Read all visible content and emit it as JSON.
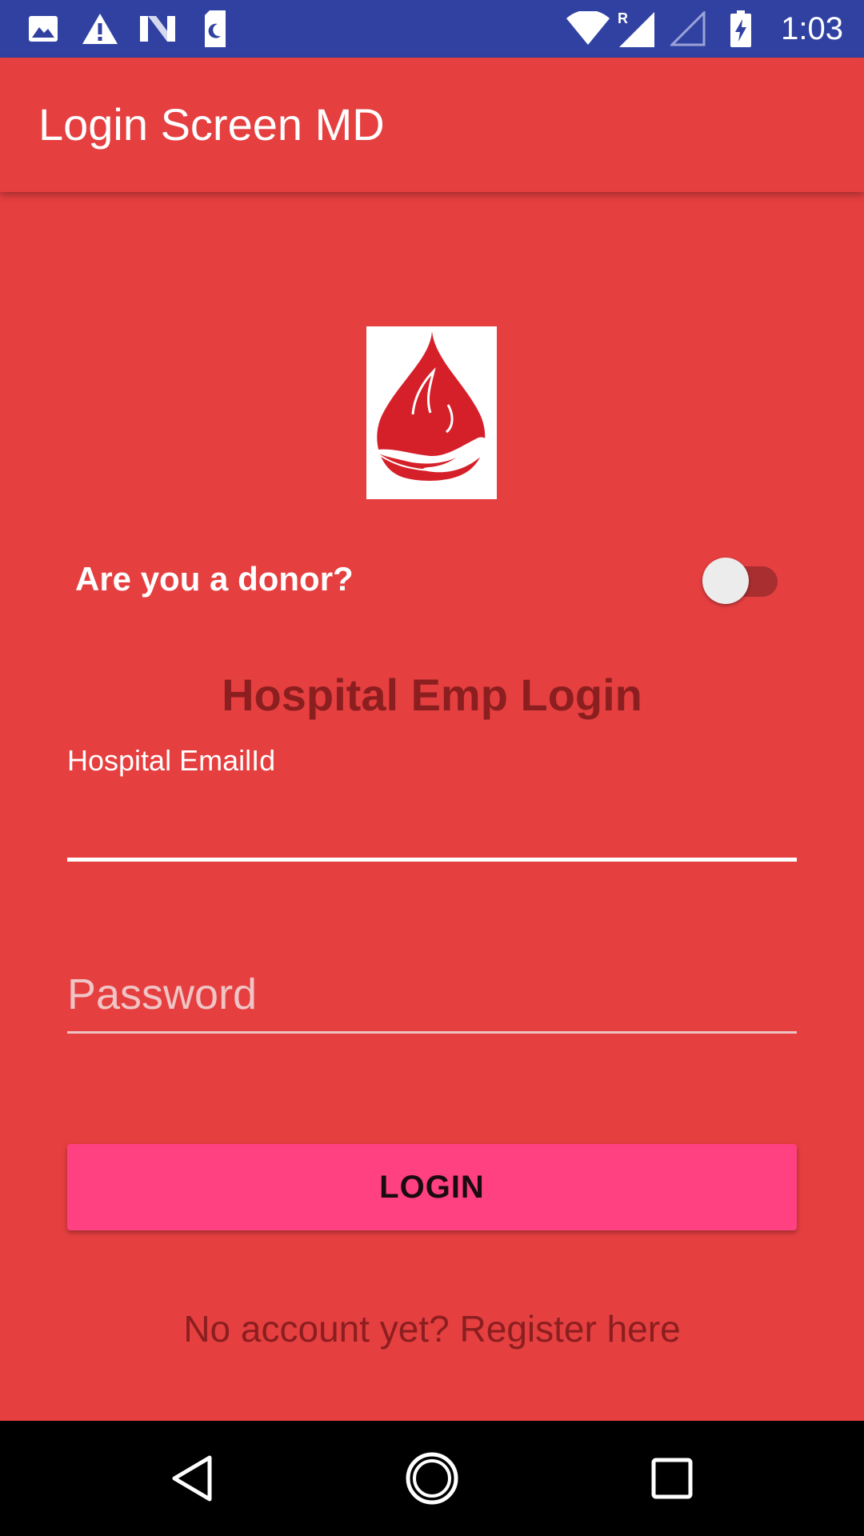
{
  "status_bar": {
    "time": "1:03",
    "left_icons": [
      "image-icon",
      "warning-icon",
      "n-logo-icon",
      "sim-moon-icon"
    ],
    "right_icons": [
      "wifi-icon",
      "signal-roaming-icon",
      "signal-empty-icon",
      "battery-charging-icon"
    ],
    "roaming_indicator": "R"
  },
  "app_bar": {
    "title": "Login Screen MD"
  },
  "logo": {
    "icon": "blood-drop-hand-icon",
    "drop_color": "#D52029"
  },
  "donor_toggle": {
    "label": "Are you a donor?",
    "checked": false
  },
  "login_form": {
    "heading": "Hospital Emp Login",
    "email": {
      "label": "Hospital EmailId",
      "value": ""
    },
    "password": {
      "placeholder": "Password",
      "value": ""
    },
    "submit_label": "LOGIN"
  },
  "register_link": {
    "text": "No account yet? Register here"
  },
  "nav_bar": {
    "buttons": [
      "back-icon",
      "home-icon",
      "recents-icon"
    ]
  },
  "colors": {
    "status_bar": "#3041A2",
    "primary": "#E53F40",
    "accent": "#FF4081",
    "heading": "#8B1E1F",
    "toggle_track": "#A82E30",
    "nav_bar": "#000000"
  }
}
